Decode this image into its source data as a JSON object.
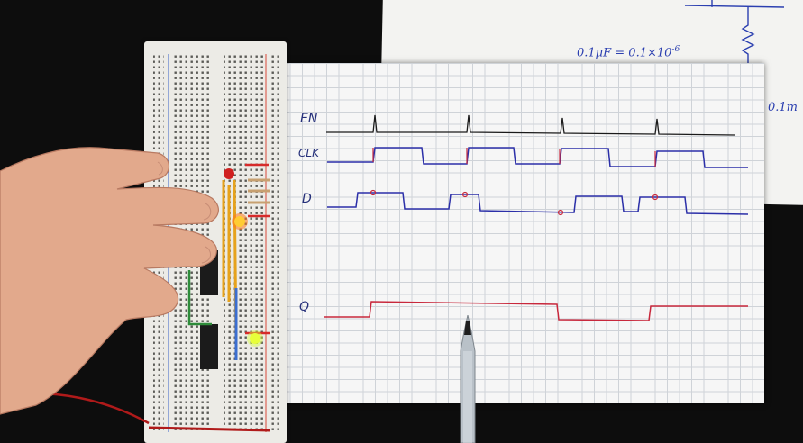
{
  "back_sheet": {
    "note_capacitance": "0.1μF = 0.1×10",
    "note_exponent": "-6",
    "note_edge": "0.1m"
  },
  "timing_diagram": {
    "signals": [
      {
        "label": "EN",
        "color": "#1a1a1a"
      },
      {
        "label": "CLK",
        "color": "#2b2fa8"
      },
      {
        "label": "D",
        "color": "#2b2fa8"
      },
      {
        "label": "Q",
        "color": "#c8283c"
      }
    ]
  },
  "breadboard": {
    "led_top_color": "#ffcc33",
    "led_bottom_color": "#e8ff3a"
  }
}
